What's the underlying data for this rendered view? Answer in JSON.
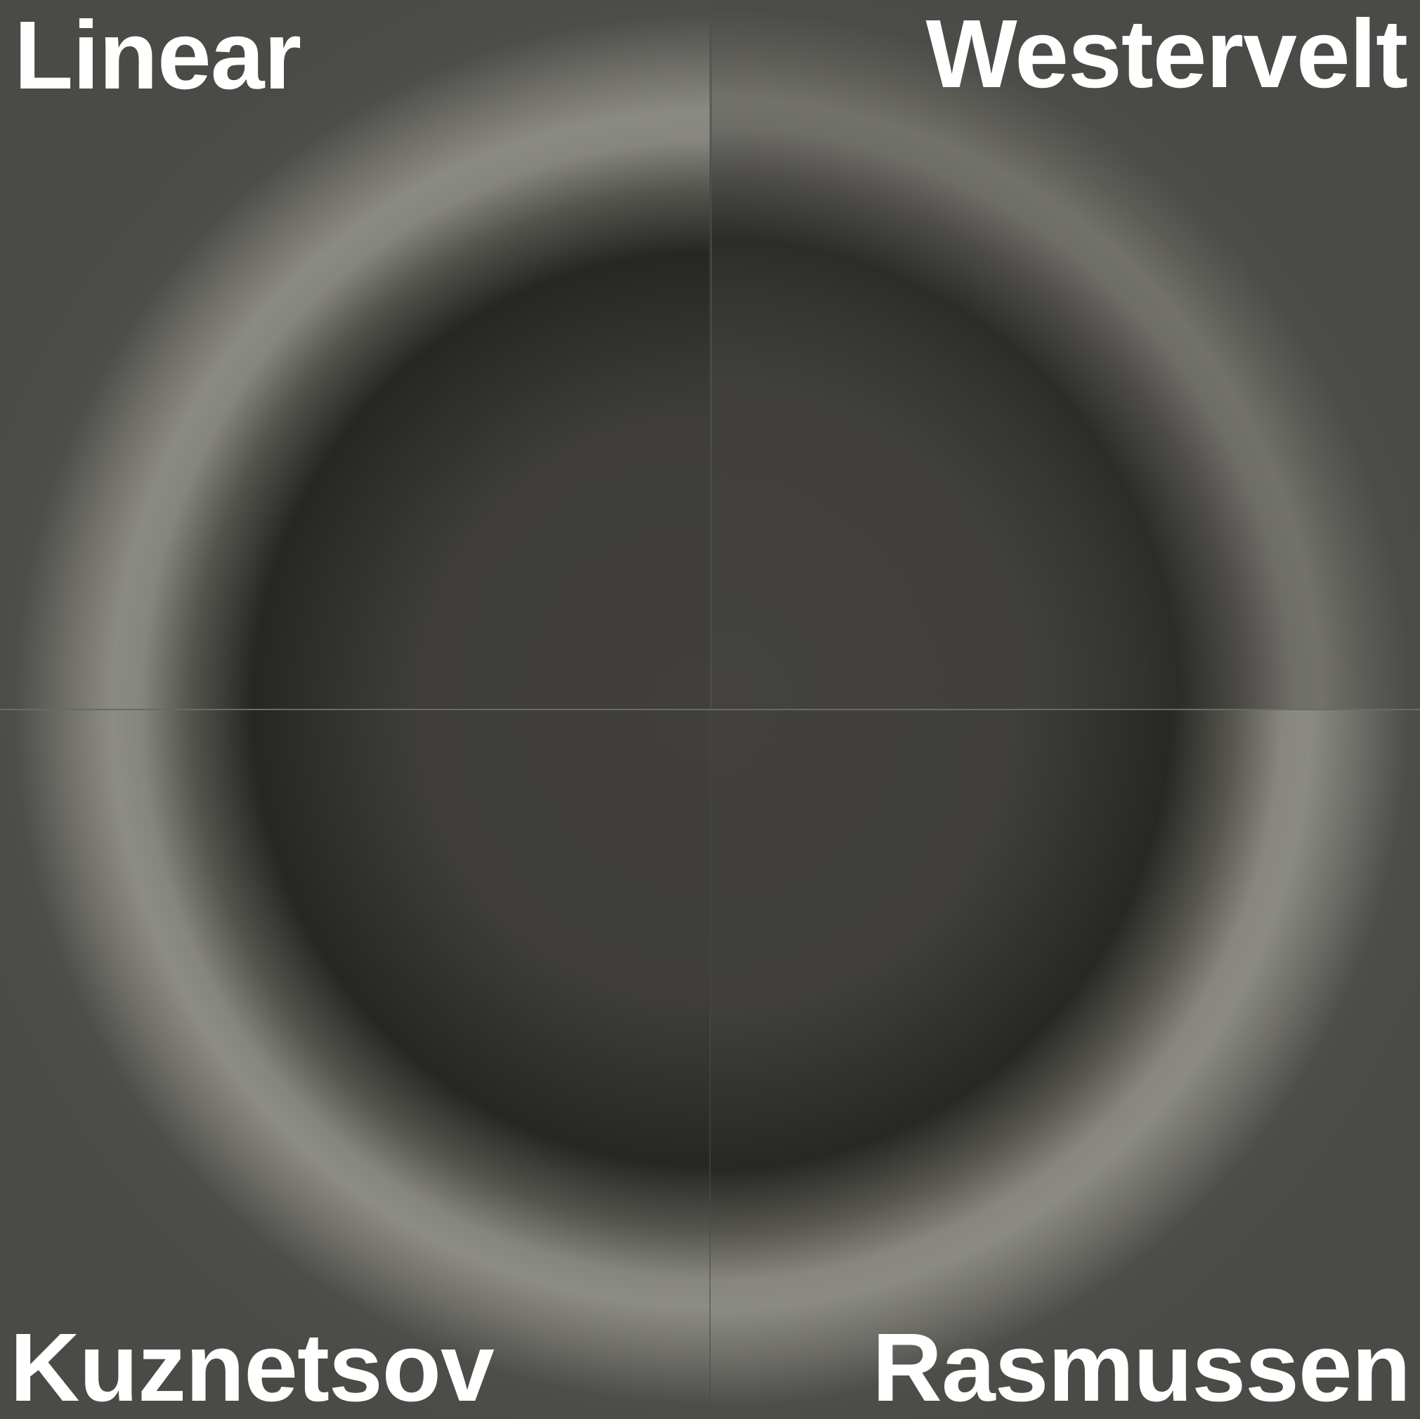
{
  "panels": {
    "top_left": {
      "label": "Linear"
    },
    "top_right": {
      "label": "Westervelt"
    },
    "bottom_left": {
      "label": "Kuznetsov"
    },
    "bottom_right": {
      "label": "Rasmussen"
    }
  },
  "colors": {
    "background": "#4a4a46",
    "ring_bright": "#8b8a84",
    "ring_dark": "#262624",
    "label": "#ffffff"
  }
}
